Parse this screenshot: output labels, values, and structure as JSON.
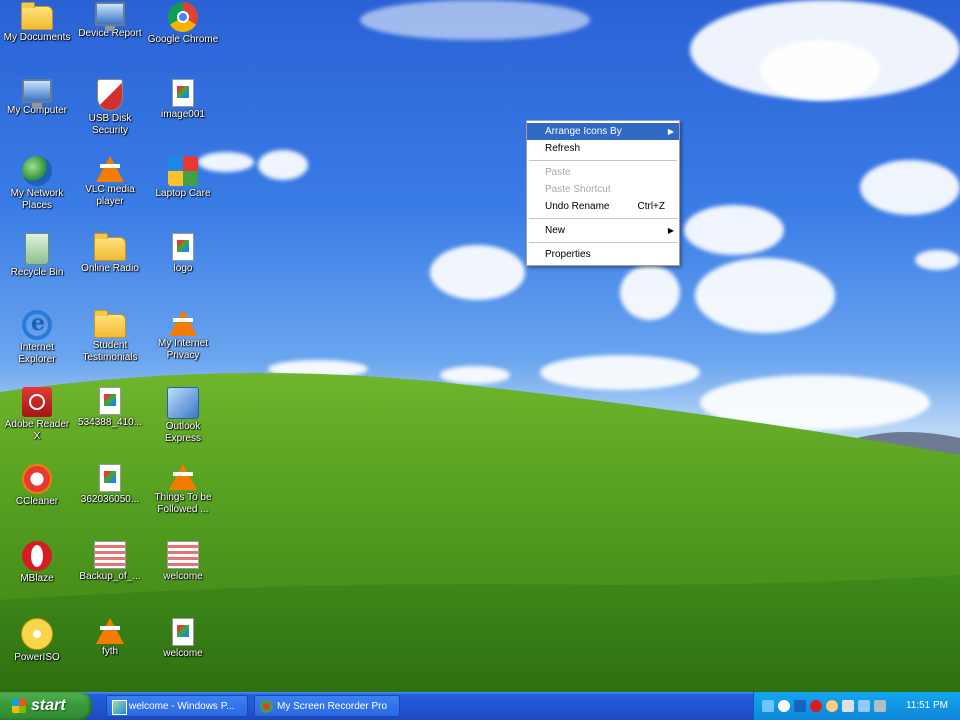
{
  "desktop_icons": [
    {
      "label": "My Documents",
      "icon": "folder-icon",
      "glyph": "g-folder"
    },
    {
      "label": "Device Report",
      "icon": "monitor-icon",
      "glyph": "g-monitor"
    },
    {
      "label": "Google Chrome",
      "icon": "chrome-icon",
      "glyph": "g-chrome"
    },
    {
      "label": "My Computer",
      "icon": "computer-icon",
      "glyph": "g-monitor"
    },
    {
      "label": "USB Disk Security",
      "icon": "shield-icon",
      "glyph": "g-shield"
    },
    {
      "label": "image001",
      "icon": "image-file-icon",
      "glyph": "g-doc"
    },
    {
      "label": "My Network Places",
      "icon": "network-icon",
      "glyph": "g-globe"
    },
    {
      "label": "VLC media player",
      "icon": "vlc-icon",
      "glyph": "g-cone"
    },
    {
      "label": "Laptop Care",
      "icon": "laptop-care-icon",
      "glyph": "g-laptop"
    },
    {
      "label": "Recycle Bin",
      "icon": "recycle-bin-icon",
      "glyph": "g-bin"
    },
    {
      "label": "Online Radio",
      "icon": "folder-icon",
      "glyph": "g-folder"
    },
    {
      "label": "logo",
      "icon": "image-file-icon",
      "glyph": "g-doc"
    },
    {
      "label": "Internet Explorer",
      "icon": "internet-explorer-icon",
      "glyph": "g-ie"
    },
    {
      "label": "Student Testimonials",
      "icon": "folder-icon",
      "glyph": "g-folder"
    },
    {
      "label": "My Internet Privacy",
      "icon": "vlc-icon",
      "glyph": "g-cone"
    },
    {
      "label": "Adobe Reader X",
      "icon": "adobe-reader-icon",
      "glyph": "g-pdf"
    },
    {
      "label": "534388_410...",
      "icon": "image-file-icon",
      "glyph": "g-doc"
    },
    {
      "label": "Outlook Express",
      "icon": "outlook-icon",
      "glyph": "g-outlook"
    },
    {
      "label": "CCleaner",
      "icon": "ccleaner-icon",
      "glyph": "g-ccleaner"
    },
    {
      "label": "362036050...",
      "icon": "image-file-icon",
      "glyph": "g-doc"
    },
    {
      "label": "Things To be Followed ...",
      "icon": "vlc-icon",
      "glyph": "g-cone"
    },
    {
      "label": "MBlaze",
      "icon": "opera-icon",
      "glyph": "g-opera"
    },
    {
      "label": "Backup_of_...",
      "icon": "document-icon",
      "glyph": "g-backup"
    },
    {
      "label": "welcome",
      "icon": "document-icon",
      "glyph": "g-backup"
    },
    {
      "label": "PowerISO",
      "icon": "disc-icon",
      "glyph": "g-disc"
    },
    {
      "label": "fyth",
      "icon": "vlc-icon",
      "glyph": "g-cone"
    },
    {
      "label": "welcome",
      "icon": "image-file-icon",
      "glyph": "g-doc"
    }
  ],
  "context_menu": {
    "items": [
      {
        "label": "Arrange Icons By",
        "type": "submenu",
        "state": "selected"
      },
      {
        "label": "Refresh",
        "type": "item",
        "state": "normal"
      },
      {
        "type": "separator"
      },
      {
        "label": "Paste",
        "type": "item",
        "state": "disabled"
      },
      {
        "label": "Paste Shortcut",
        "type": "item",
        "state": "disabled"
      },
      {
        "label": "Undo Rename",
        "shortcut": "Ctrl+Z",
        "type": "item",
        "state": "normal"
      },
      {
        "type": "separator"
      },
      {
        "label": "New",
        "type": "submenu",
        "state": "normal"
      },
      {
        "type": "separator"
      },
      {
        "label": "Properties",
        "type": "item",
        "state": "normal"
      }
    ]
  },
  "taskbar": {
    "start_label": "start",
    "tasks": [
      {
        "label": "welcome - Windows P...",
        "icon": "picture-viewer-icon"
      },
      {
        "label": "My Screen Recorder Pro",
        "icon": "screen-recorder-icon"
      }
    ],
    "clock": "11:51 PM"
  },
  "colors": {
    "menu_highlight": "#316ac5",
    "taskbar_blue": "#245edb",
    "start_green": "#3b9c3c",
    "tray_blue": "#0f86d8"
  }
}
